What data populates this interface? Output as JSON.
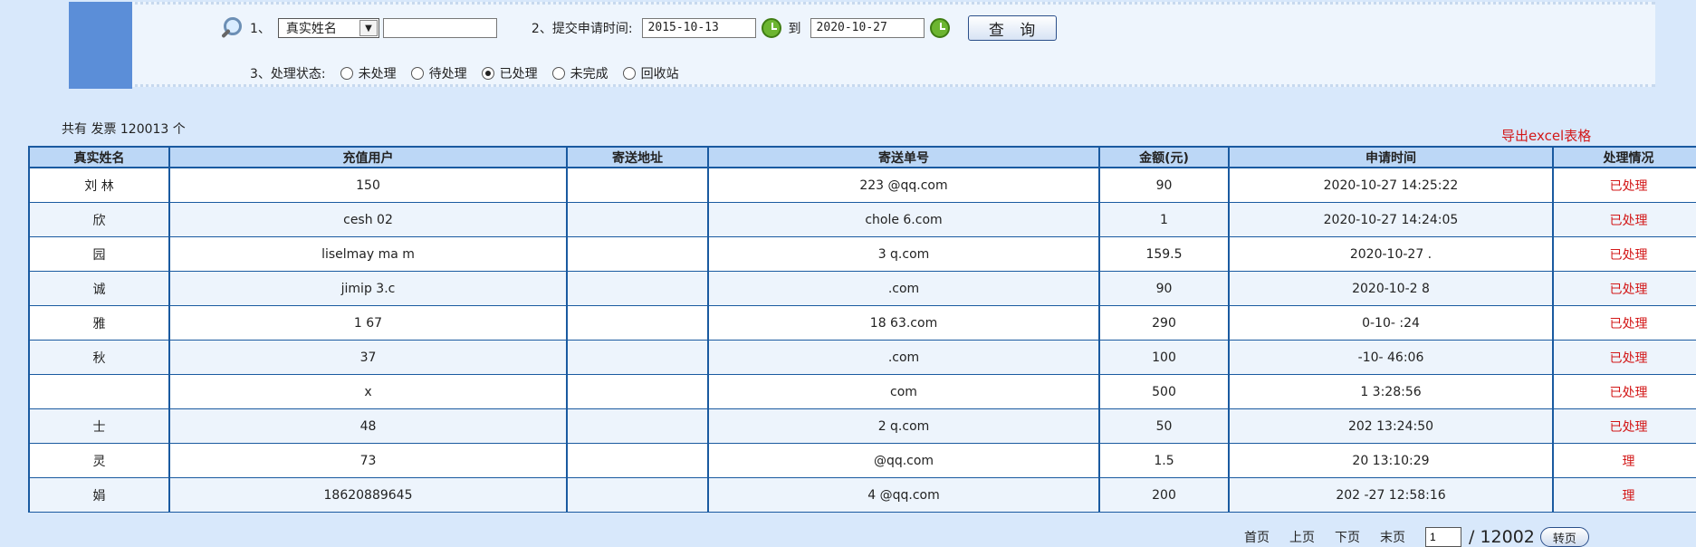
{
  "search": {
    "step1": "1、",
    "field_select": "真实姓名",
    "keyword_value": "",
    "step2": "2、提交申请时间:",
    "date_from": "2015-10-13",
    "date_to_label": "到",
    "date_to": "2020-10-27",
    "query_label": "查 询",
    "step3": "3、处理状态:",
    "status_options": [
      {
        "label": "未处理",
        "checked": false
      },
      {
        "label": "待处理",
        "checked": false
      },
      {
        "label": "已处理",
        "checked": true
      },
      {
        "label": "未完成",
        "checked": false
      },
      {
        "label": "回收站",
        "checked": false
      }
    ]
  },
  "summary": "共有 发票 120013 个",
  "export_label": "导出excel表格",
  "table": {
    "headers": [
      "真实姓名",
      "充值用户",
      "寄送地址",
      "寄送单号",
      "金额(元)",
      "申请时间",
      "处理情况"
    ],
    "rows": [
      [
        "刘 林",
        "150",
        "",
        "223 @qq.com",
        "90",
        "2020-10-27 14:25:22",
        "已处理"
      ],
      [
        "欣",
        "cesh 02",
        "",
        "chole 6.com",
        "1",
        "2020-10-27 14:24:05",
        "已处理"
      ],
      [
        "园",
        "liselmay ma m",
        "",
        "3 q.com",
        "159.5",
        "2020-10-27 .",
        "已处理"
      ],
      [
        "诚",
        "jimip 3.c",
        "",
        ".com",
        "90",
        "2020-10-2 8",
        "已处理"
      ],
      [
        "雅",
        "1 67",
        "",
        "18 63.com",
        "290",
        "0-10- :24",
        "已处理"
      ],
      [
        "秋",
        "37",
        "",
        ".com",
        "100",
        "-10- 46:06",
        "已处理"
      ],
      [
        "",
        "x",
        "",
        "com",
        "500",
        "1 3:28:56",
        "已处理"
      ],
      [
        "士",
        "48",
        "",
        "2 q.com",
        "50",
        "202 13:24:50",
        "已处理"
      ],
      [
        "灵",
        "73",
        "",
        "@qq.com",
        "1.5",
        "20 13:10:29",
        "理"
      ],
      [
        "娟",
        "18620889645",
        "",
        "4 @qq.com",
        "200",
        "202 -27 12:58:16",
        "理"
      ]
    ]
  },
  "pager": {
    "first": "首页",
    "prev": "上页",
    "next": "下页",
    "last": "末页",
    "current": "1",
    "total_pages": "/ 12002",
    "go": "转页"
  }
}
